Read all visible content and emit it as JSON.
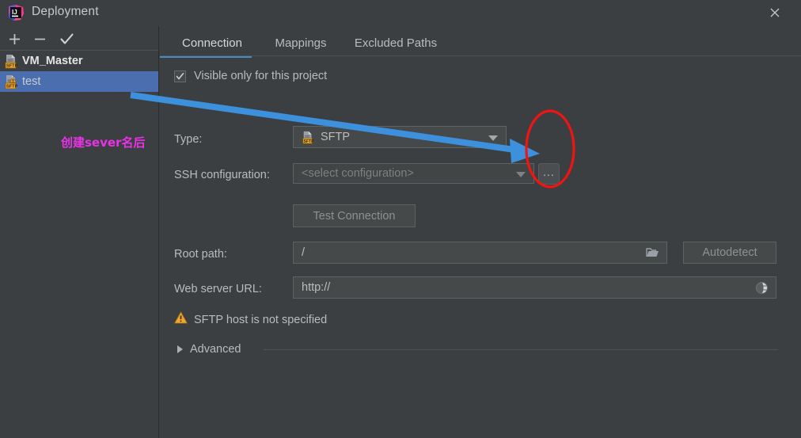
{
  "window": {
    "title": "Deployment",
    "app_icon": "intellij-idea-logo",
    "close_label": "✕"
  },
  "sidebar": {
    "toolbar": [
      {
        "name": "add",
        "icon": "plus-icon",
        "glyph": "+"
      },
      {
        "name": "remove",
        "icon": "minus-icon",
        "glyph": "−"
      },
      {
        "name": "set-default",
        "icon": "check-icon",
        "glyph": "✓"
      }
    ],
    "servers": [
      {
        "label": "VM_Master",
        "icon": "sftp-server-icon",
        "selected": false,
        "bold": true,
        "warning": false
      },
      {
        "label": "test",
        "icon": "sftp-server-warning-icon",
        "selected": true,
        "bold": false,
        "warning": true
      }
    ]
  },
  "annotations": {
    "chinese_note": "创建sever名后",
    "note_color": "#e832e8",
    "arrow_color": "#3d90db",
    "ellipse_color": "#f01414"
  },
  "content": {
    "tabs": [
      {
        "label": "Connection",
        "active": true
      },
      {
        "label": "Mappings",
        "active": false
      },
      {
        "label": "Excluded Paths",
        "active": false
      }
    ],
    "visible_only": {
      "label": "Visible only for this project",
      "checked": true
    },
    "type": {
      "label": "Type:",
      "mnemonic": "T",
      "value": "SFTP",
      "icon": "sftp-icon"
    },
    "ssh_configuration": {
      "label": "SSH configuration:",
      "mnemonic": "S",
      "placeholder": "<select configuration>",
      "value": "",
      "browse_label": "..."
    },
    "test_connection": {
      "label": "Test Connection",
      "enabled": false
    },
    "root_path": {
      "label": "Root path:",
      "mnemonic": "R",
      "value": "/",
      "browse_icon": "folder-icon"
    },
    "autodetect": {
      "label": "Autodetect",
      "enabled": false
    },
    "web_server_url": {
      "label": "Web server URL:",
      "mnemonic": "W",
      "value": "http://",
      "open_icon": "globe-icon"
    },
    "warning": {
      "icon": "warning-triangle-icon",
      "text": "SFTP host is not specified"
    },
    "advanced": {
      "label": "Advanced",
      "expanded": false,
      "icon": "chevron-right-icon"
    }
  },
  "colors": {
    "background": "#3c3f41",
    "field_bg": "#45494a",
    "selection": "#4b6eaf",
    "tab_accent": "#4a88c7",
    "text": "#bbbbbb",
    "warning": "#f0a732"
  }
}
